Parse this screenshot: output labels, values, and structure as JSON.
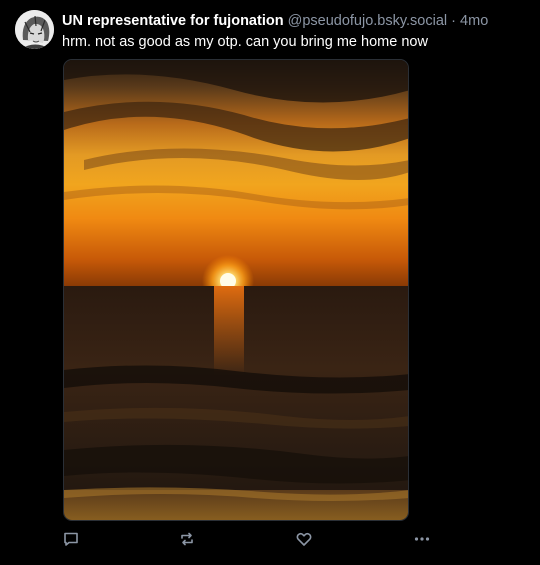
{
  "post": {
    "author": {
      "display_name": "UN representative for fujonation",
      "handle": "@pseudofujo.bsky.social",
      "avatar_icon": "avatar-manga-drawing"
    },
    "separator": "·",
    "timestamp": "4mo",
    "text": "hrm. not as good as my otp. can you bring me home now",
    "media": {
      "subject": "sunset-over-ocean-photo"
    },
    "actions": [
      {
        "name": "reply",
        "icon": "comment-icon"
      },
      {
        "name": "repost",
        "icon": "repost-icon"
      },
      {
        "name": "like",
        "icon": "heart-icon"
      },
      {
        "name": "more",
        "icon": "ellipsis-icon"
      }
    ]
  },
  "colors": {
    "background": "#000000",
    "text_primary": "#ffffff",
    "text_secondary": "#8c96a5"
  }
}
